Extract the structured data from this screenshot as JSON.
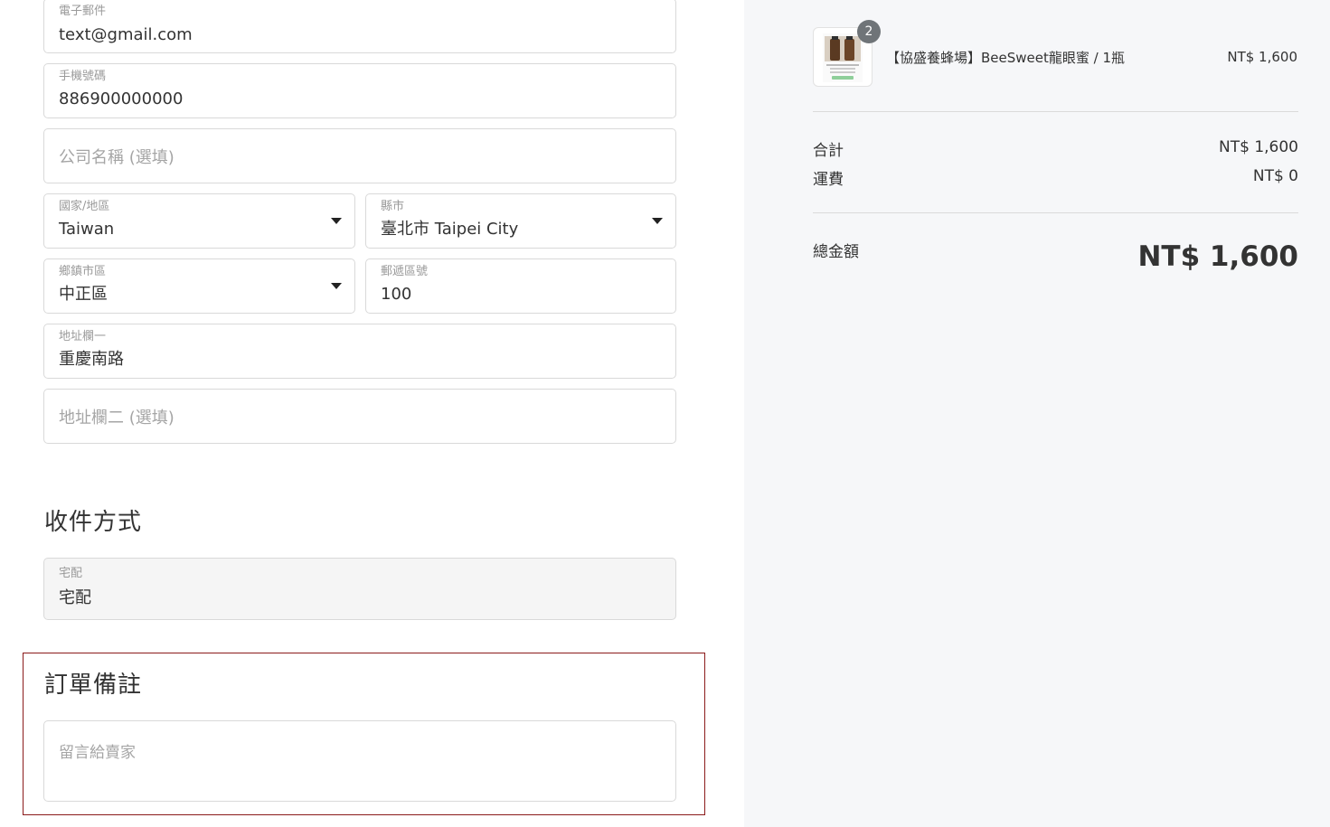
{
  "contact": {
    "email": {
      "label": "電子郵件",
      "value": "text@gmail.com"
    },
    "phone": {
      "label": "手機號碼",
      "value": "886900000000"
    },
    "company": {
      "placeholder": "公司名稱 (選填)"
    }
  },
  "address": {
    "country": {
      "label": "國家/地區",
      "value": "Taiwan"
    },
    "city": {
      "label": "縣市",
      "value": "臺北市 Taipei City"
    },
    "district": {
      "label": "鄉鎮市區",
      "value": "中正區"
    },
    "postal": {
      "label": "郵遞區號",
      "value": "100"
    },
    "line1": {
      "label": "地址欄一",
      "value": "重慶南路"
    },
    "line2": {
      "placeholder": "地址欄二 (選填)"
    }
  },
  "delivery": {
    "title": "收件方式",
    "method": {
      "label": "宅配",
      "value": "宅配"
    }
  },
  "notes": {
    "title": "訂單備註",
    "placeholder": "留言給賣家"
  },
  "summary": {
    "item": {
      "quantity": "2",
      "name": "【協盛養蜂場】BeeSweet龍眼蜜 / 1瓶",
      "price": "NT$ 1,600"
    },
    "subtotal": {
      "label": "合計",
      "value": "NT$ 1,600"
    },
    "shipping": {
      "label": "運費",
      "value": "NT$ 0"
    },
    "total": {
      "label": "總金額",
      "value": "NT$ 1,600"
    }
  },
  "colors": {
    "accent_border": "#8b1a1a",
    "badge": "#6f7478",
    "panel_bg": "#f6f7f9"
  }
}
